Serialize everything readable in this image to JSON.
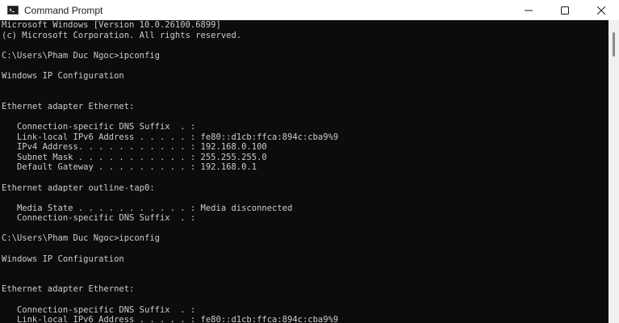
{
  "window": {
    "title": "Command Prompt",
    "icon": "cmd-icon"
  },
  "controls": {
    "minimize": "minimize-icon",
    "maximize": "maximize-icon",
    "close": "close-icon"
  },
  "console": {
    "lines": [
      "Microsoft Windows [Version 10.0.26100.6899]",
      "(c) Microsoft Corporation. All rights reserved.",
      "",
      "C:\\Users\\Pham Duc Ngoc>ipconfig",
      "",
      "Windows IP Configuration",
      "",
      "",
      "Ethernet adapter Ethernet:",
      "",
      "   Connection-specific DNS Suffix  . :",
      "   Link-local IPv6 Address . . . . . : fe80::d1cb:ffca:894c:cba9%9",
      "   IPv4 Address. . . . . . . . . . . : 192.168.0.100",
      "   Subnet Mask . . . . . . . . . . . : 255.255.255.0",
      "   Default Gateway . . . . . . . . . : 192.168.0.1",
      "",
      "Ethernet adapter outline-tap0:",
      "",
      "   Media State . . . . . . . . . . . : Media disconnected",
      "   Connection-specific DNS Suffix  . :",
      "",
      "C:\\Users\\Pham Duc Ngoc>ipconfig",
      "",
      "Windows IP Configuration",
      "",
      "",
      "Ethernet adapter Ethernet:",
      "",
      "   Connection-specific DNS Suffix  . :",
      "   Link-local IPv6 Address . . . . . : fe80::d1cb:ffca:894c:cba9%9"
    ]
  }
}
